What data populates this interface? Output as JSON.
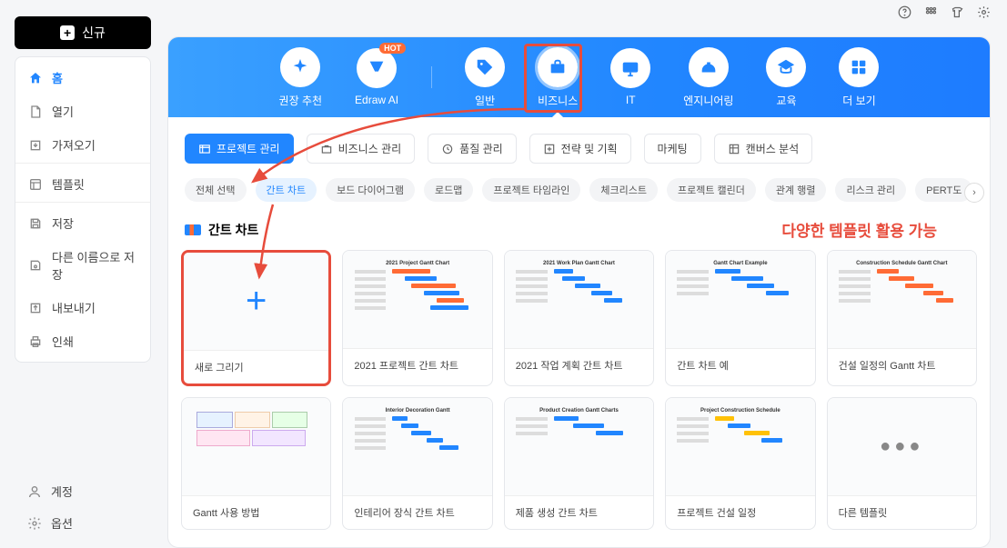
{
  "titlebar": {
    "help": "?",
    "grid": "⊞",
    "shirt": "👕",
    "gear": "⚙"
  },
  "newButton": {
    "label": "신규"
  },
  "sidebar": {
    "items": [
      {
        "id": "home",
        "label": "홈",
        "active": true
      },
      {
        "id": "open",
        "label": "열기"
      },
      {
        "id": "import",
        "label": "가져오기",
        "divider": true
      },
      {
        "id": "templates",
        "label": "템플릿",
        "divider": true
      },
      {
        "id": "save",
        "label": "저장"
      },
      {
        "id": "saveas",
        "label": "다른 이름으로 저장"
      },
      {
        "id": "export",
        "label": "내보내기"
      },
      {
        "id": "print",
        "label": "인쇄"
      }
    ],
    "bottom": [
      {
        "id": "account",
        "label": "계정"
      },
      {
        "id": "options",
        "label": "옵션"
      }
    ]
  },
  "categories": {
    "items": [
      {
        "id": "rec",
        "label": "권장 추천"
      },
      {
        "id": "edrawai",
        "label": "Edraw AI",
        "hot": true
      },
      {
        "id": "general",
        "label": "일반"
      },
      {
        "id": "business",
        "label": "비즈니스",
        "selected": true
      },
      {
        "id": "it",
        "label": "IT"
      },
      {
        "id": "engineering",
        "label": "엔지니어링"
      },
      {
        "id": "education",
        "label": "교육"
      },
      {
        "id": "more",
        "label": "더 보기"
      }
    ]
  },
  "subTabs": {
    "items": [
      {
        "id": "project",
        "label": "프로젝트 관리",
        "active": true
      },
      {
        "id": "bizmanage",
        "label": "비즈니스 관리"
      },
      {
        "id": "quality",
        "label": "품질 관리"
      },
      {
        "id": "strategy",
        "label": "전략 및 기획"
      },
      {
        "id": "marketing",
        "label": "마케팅"
      },
      {
        "id": "canvas",
        "label": "캔버스 분석"
      }
    ]
  },
  "chips": {
    "items": [
      {
        "id": "all",
        "label": "전체 선택"
      },
      {
        "id": "gantt",
        "label": "간트 차트",
        "active": true
      },
      {
        "id": "board",
        "label": "보드 다이어그램"
      },
      {
        "id": "roadmap",
        "label": "로드맵"
      },
      {
        "id": "timeline",
        "label": "프로젝트 타임라인"
      },
      {
        "id": "checklist",
        "label": "체크리스트"
      },
      {
        "id": "calendar",
        "label": "프로젝트 캘린더"
      },
      {
        "id": "matrix",
        "label": "관계 행렬"
      },
      {
        "id": "risk",
        "label": "리스크 관리"
      },
      {
        "id": "pert",
        "label": "PERT도"
      }
    ],
    "scrollNext": "›"
  },
  "section": {
    "title": "간트 차트",
    "annotation": "다양한 템플릿 활용 가능"
  },
  "cards": {
    "row1": [
      {
        "id": "new",
        "label": "새로 그리기",
        "type": "new"
      },
      {
        "id": "t1",
        "label": "2021 프로젝트 간트 차트",
        "thumbTitle": "2021 Project Gantt Chart"
      },
      {
        "id": "t2",
        "label": "2021 작업 계획 간트 차트",
        "thumbTitle": "2021 Work Plan Gantt Chart"
      },
      {
        "id": "t3",
        "label": "간트 차트 예",
        "thumbTitle": "Gantt Chart Example"
      },
      {
        "id": "t4",
        "label": "건설 일정의 Gantt 차트",
        "thumbTitle": "Construction Schedule Gantt Chart"
      }
    ],
    "row2": [
      {
        "id": "t5",
        "label": "Gantt 사용 방법",
        "thumbTitle": ""
      },
      {
        "id": "t6",
        "label": "인테리어 장식 간트 차트",
        "thumbTitle": "Interior Decoration Gantt"
      },
      {
        "id": "t7",
        "label": "제품 생성 간트 차트",
        "thumbTitle": "Product Creation Gantt Charts"
      },
      {
        "id": "t8",
        "label": "프로젝트 건설 일정",
        "thumbTitle": "Project Construction Schedule"
      },
      {
        "id": "more",
        "label": "다른 템플릿",
        "type": "more"
      }
    ]
  },
  "colors": {
    "accent": "#2186ff",
    "highlight": "#e74c3c",
    "hot": "#ff6b35"
  }
}
